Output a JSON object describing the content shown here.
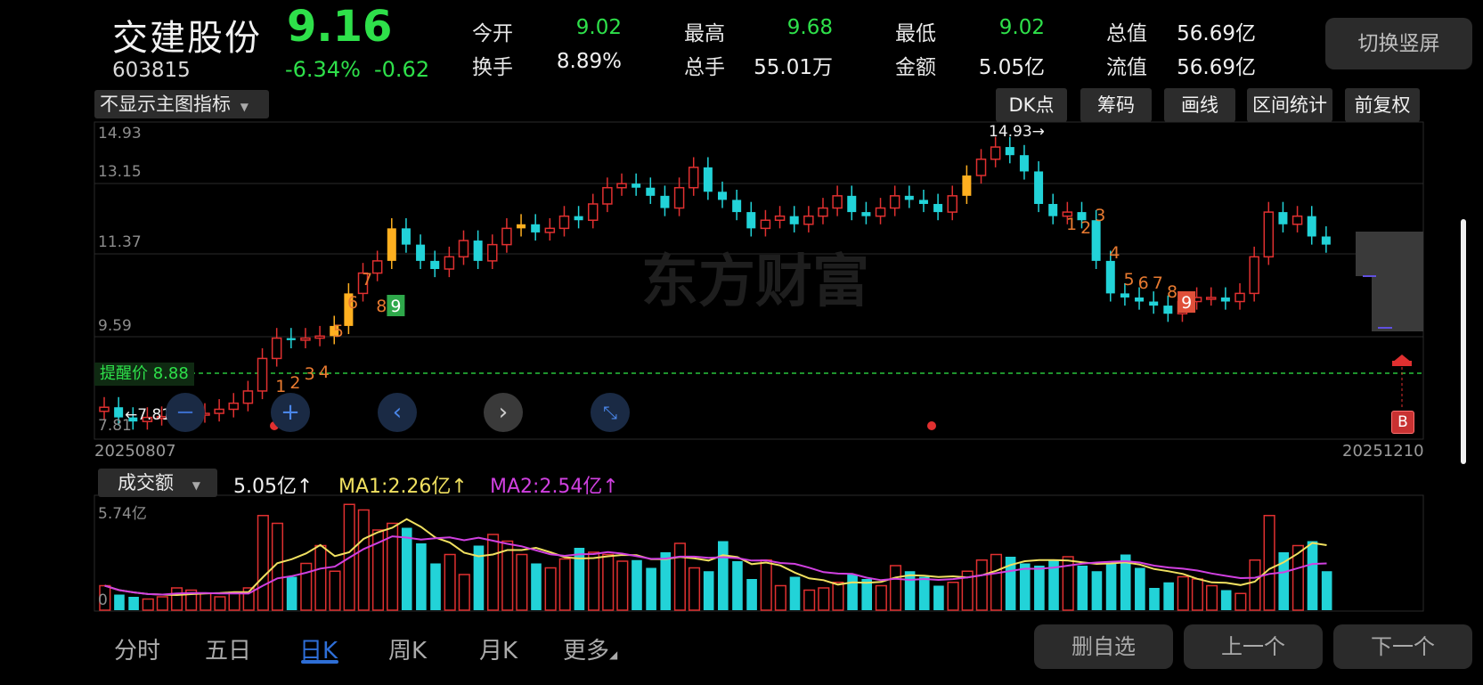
{
  "header": {
    "name": "交建股份",
    "code": "603815",
    "price": "9.16",
    "change_pct": "-6.34%",
    "change_amt": "-0.62",
    "toggle_button": "切换竖屏"
  },
  "quote": [
    {
      "label": "今开",
      "value": "9.02",
      "color": "#2ee04a"
    },
    {
      "label": "最高",
      "value": "9.68",
      "color": "#2ee04a"
    },
    {
      "label": "最低",
      "value": "9.02",
      "color": "#2ee04a"
    },
    {
      "label": "总值",
      "value": "56.69亿",
      "color": "#f0f0f0"
    },
    {
      "label": "换手",
      "value": "8.89%",
      "color": "#f0f0f0"
    },
    {
      "label": "总手",
      "value": "55.01万",
      "color": "#f0f0f0"
    },
    {
      "label": "金额",
      "value": "5.05亿",
      "color": "#f0f0f0"
    },
    {
      "label": "流值",
      "value": "56.69亿",
      "color": "#f0f0f0"
    }
  ],
  "main_chart": {
    "indicator_select": "不显示主图指标",
    "tools": [
      "DK点",
      "筹码",
      "画线",
      "区间统计",
      "前复权"
    ],
    "y_ticks": [
      "14.93",
      "13.15",
      "11.37",
      "9.59",
      "7.81"
    ],
    "high_marker": "14.93→",
    "low_marker": "←7.81",
    "alert_label": "提醒价 8.88",
    "buy_marker": "B",
    "date_start": "20250807",
    "date_end": "20251210",
    "watermark": "东方财富",
    "nine_turn_up": [
      "1",
      "2",
      "3",
      "4",
      "5",
      "6",
      "7",
      "8",
      "9"
    ],
    "nine_turn_down": [
      "1",
      "2",
      "3",
      "4",
      "5",
      "6",
      "7",
      "8",
      "9"
    ]
  },
  "volume_chart": {
    "indicator_select": "成交额",
    "value": "5.05亿↑",
    "ma1": "MA1:2.26亿↑",
    "ma2": "MA2:2.54亿↑",
    "y_top": "5.74亿",
    "y_bottom": "0"
  },
  "bottom_tabs": [
    "分时",
    "五日",
    "日K",
    "周K",
    "月K",
    "更多"
  ],
  "bottom_buttons": [
    "删自选",
    "上一个",
    "下一个"
  ],
  "colors": {
    "up": "#e03030",
    "down": "#22d3d8",
    "accent": "#2e6ed6",
    "yellow": "#ffb020",
    "ma1": "#f0e060",
    "ma2": "#d040e0"
  }
}
